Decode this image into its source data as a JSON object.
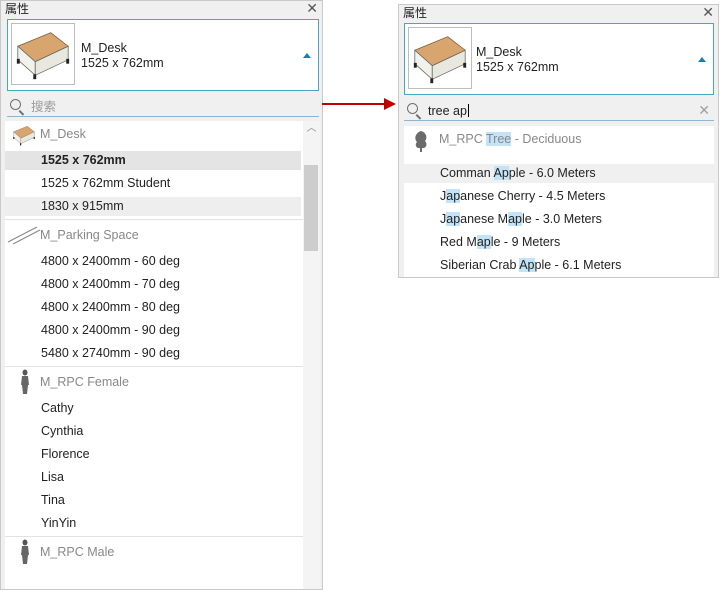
{
  "left": {
    "title": "属性",
    "type_name": "M_Desk",
    "type_size": "1525 x 762mm",
    "search_placeholder": "搜索",
    "groups": [
      {
        "name": "M_Desk",
        "icon": "desk-icon",
        "items": [
          "1525 x 762mm",
          "1525 x 762mm Student",
          "1830 x 915mm"
        ]
      },
      {
        "name": "M_Parking Space",
        "icon": "parking-space-icon",
        "items": [
          "4800 x 2400mm - 60 deg",
          "4800 x 2400mm - 70 deg",
          "4800 x 2400mm - 80 deg",
          "4800 x 2400mm - 90 deg",
          "5480 x 2740mm - 90 deg"
        ]
      },
      {
        "name": "M_RPC Female",
        "icon": "person-icon",
        "items": [
          "Cathy",
          "Cynthia",
          "Florence",
          "Lisa",
          "Tina",
          "YinYin"
        ]
      },
      {
        "name": "M_RPC Male",
        "icon": "person-icon",
        "items": []
      }
    ]
  },
  "right": {
    "title": "属性",
    "type_name": "M_Desk",
    "type_size": "1525 x 762mm",
    "search_value": "tree ap",
    "group": {
      "pre": "M_RPC ",
      "hl": "Tree",
      "post": " - Deciduous",
      "icon": "tree-icon"
    },
    "items": [
      [
        {
          "t": "Comman "
        },
        {
          "t": "Ap",
          "h": true
        },
        {
          "t": "ple - 6.0 Meters"
        }
      ],
      [
        {
          "t": "J"
        },
        {
          "t": "ap",
          "h": true
        },
        {
          "t": "anese Cherry - 4.5 Meters"
        }
      ],
      [
        {
          "t": "J"
        },
        {
          "t": "ap",
          "h": true
        },
        {
          "t": "anese M"
        },
        {
          "t": "ap",
          "h": true
        },
        {
          "t": "le - 3.0 Meters"
        }
      ],
      [
        {
          "t": "Red M"
        },
        {
          "t": "ap",
          "h": true
        },
        {
          "t": "le - 9 Meters"
        }
      ],
      [
        {
          "t": "Siberian Crab "
        },
        {
          "t": "Ap",
          "h": true
        },
        {
          "t": "ple - 6.1 Meters"
        }
      ]
    ]
  },
  "colors": {
    "arrow": "#c00000",
    "accent": "#49a6c2",
    "highlight": "#c3e3f6"
  }
}
